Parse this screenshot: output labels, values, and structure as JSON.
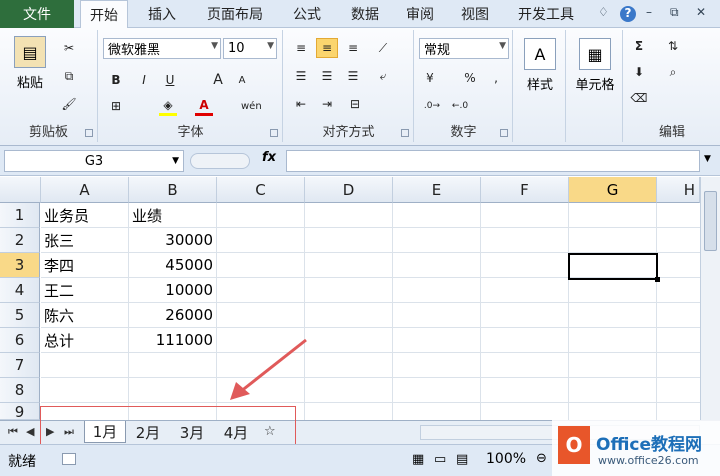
{
  "tabs": {
    "file": "文件",
    "items": [
      "开始",
      "插入",
      "页面布局",
      "公式",
      "数据",
      "审阅",
      "视图",
      "开发工具"
    ]
  },
  "winctl": [
    "♢",
    "?",
    "–",
    "⧉",
    "✕"
  ],
  "ribbon": {
    "clipboard": {
      "paste": "粘贴",
      "label": "剪贴板"
    },
    "font": {
      "name": "微软雅黑",
      "size": "10",
      "label": "字体",
      "bold": "B",
      "italic": "I",
      "underline": "U",
      "grow": "A",
      "shrink": "A",
      "wen": "wén"
    },
    "alignment": {
      "label": "对齐方式"
    },
    "number": {
      "format": "常规",
      "pct": "%",
      "comma": ",",
      "label": "数字"
    },
    "styles": {
      "label": "样式"
    },
    "cells": {
      "label": "单元格"
    },
    "editing": {
      "label": "编辑",
      "sigma": "Σ"
    }
  },
  "namebox": "G3",
  "fx": "fx",
  "columns": [
    "A",
    "B",
    "C",
    "D",
    "E",
    "F",
    "G",
    "H"
  ],
  "rows": [
    "1",
    "2",
    "3",
    "4",
    "5",
    "6",
    "7",
    "8",
    "9"
  ],
  "cells": [
    [
      "业务员",
      "业绩"
    ],
    [
      "张三",
      "30000"
    ],
    [
      "李四",
      "45000"
    ],
    [
      "王二",
      "10000"
    ],
    [
      "陈六",
      "26000"
    ],
    [
      "总计",
      "111000"
    ]
  ],
  "sheets": [
    "1月",
    "2月",
    "3月",
    "4月"
  ],
  "status": {
    "ready": "就绪",
    "zoom": "100%"
  },
  "logo": {
    "brand": "Office教程网",
    "url": "www.office26.com"
  },
  "colors": {
    "file": "#2e6e3c",
    "active_header": "#f9d988",
    "annotation": "#e05a5a"
  }
}
